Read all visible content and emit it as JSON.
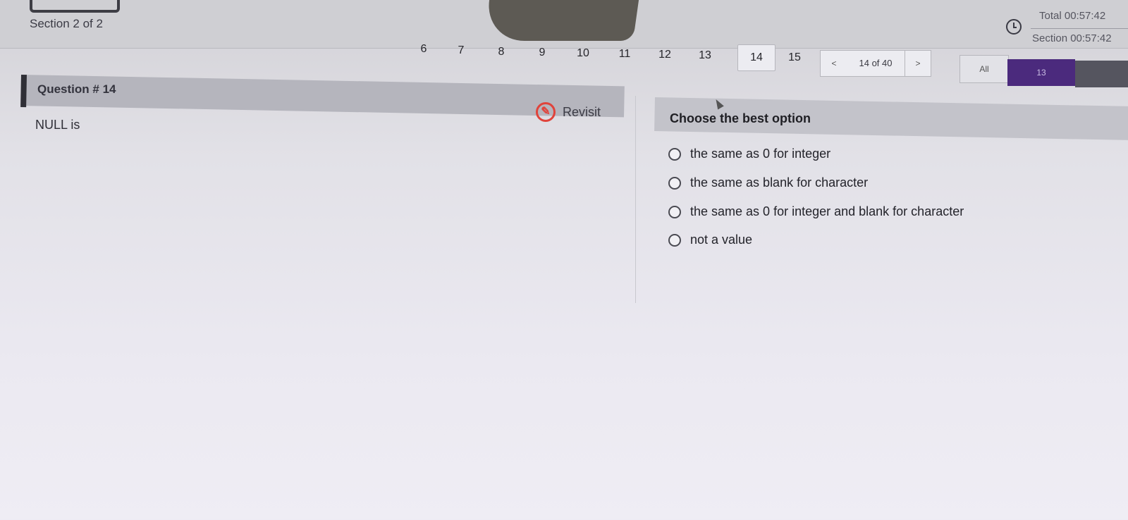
{
  "header": {
    "section_label": "Section 2 of 2",
    "timer_total": "Total 00:57:42",
    "timer_section": "Section 00:57:42"
  },
  "pager": {
    "pages": [
      "6",
      "7",
      "8",
      "9",
      "10",
      "11",
      "12",
      "13",
      "14",
      "15"
    ],
    "current_page": "14",
    "prev_label": "<",
    "counter": "14 of 40",
    "next_label": ">",
    "filter_all": "All",
    "answered_count": "13"
  },
  "question": {
    "number_label": "Question # 14",
    "revisit_label": "Revisit",
    "text": "NULL is"
  },
  "answers": {
    "title": "Choose the best option",
    "options": [
      "the same as 0 for integer",
      "the same as blank for character",
      "the same as 0 for integer and blank for character",
      "not a value"
    ]
  },
  "colors": {
    "accent_purple": "#4b2a7d",
    "revisit_red": "#e0433b"
  }
}
